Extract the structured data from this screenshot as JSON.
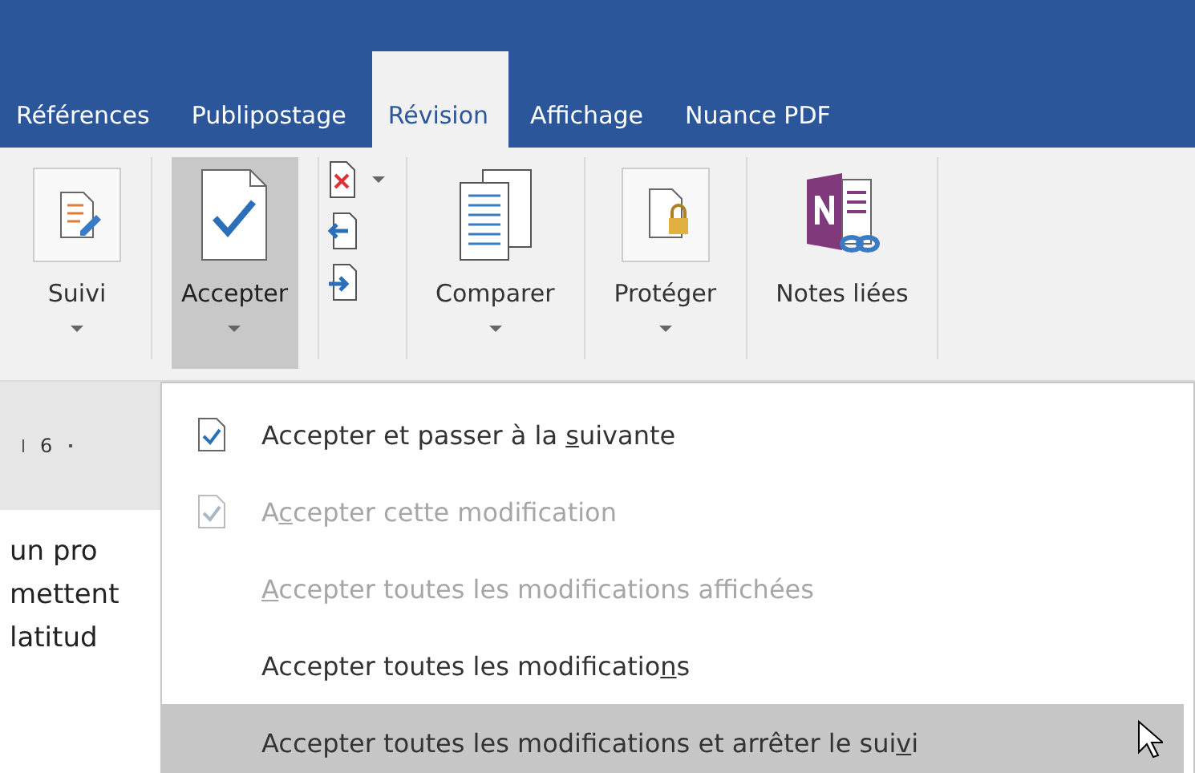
{
  "tabs": [
    {
      "label": "Références",
      "selected": false
    },
    {
      "label": "Publipostage",
      "selected": false
    },
    {
      "label": "Révision",
      "selected": true
    },
    {
      "label": "Affichage",
      "selected": false
    },
    {
      "label": "Nuance PDF",
      "selected": false
    }
  ],
  "ribbon": [
    {
      "kind": "track",
      "label": "Suivi",
      "dropdown": true,
      "pressed": false
    },
    {
      "kind": "accept",
      "label": "Accepter",
      "dropdown": true,
      "pressed": true
    },
    {
      "kind": "small-stack"
    },
    {
      "kind": "compare",
      "label": "Comparer",
      "dropdown": true,
      "pressed": false
    },
    {
      "kind": "protect",
      "label": "Protéger",
      "dropdown": true,
      "pressed": false
    },
    {
      "kind": "notes",
      "label": "Notes liées",
      "dropdown": false,
      "pressed": false
    }
  ],
  "ruler": {
    "mark": "6"
  },
  "document": {
    "lines": [
      "un pro",
      "mettent",
      "latitud"
    ]
  },
  "menu": [
    {
      "kind": "with-icon",
      "before": "Accepter et passer à la ",
      "key": "s",
      "after": "uivante",
      "disabled": false,
      "selected": false
    },
    {
      "kind": "with-icon",
      "before": "A",
      "key": "c",
      "after": "cepter cette modification",
      "disabled": true,
      "selected": false
    },
    {
      "kind": "text",
      "key": "A",
      "after": "ccepter toutes les modifications affichées",
      "disabled": true,
      "selected": false
    },
    {
      "kind": "text",
      "before": "Accepter toutes les modificatio",
      "key": "n",
      "after": "s",
      "disabled": false,
      "selected": false
    },
    {
      "kind": "text",
      "before": "Accepter toutes les modifications et arrêter le sui",
      "key": "v",
      "after": "i",
      "disabled": false,
      "selected": true
    }
  ]
}
